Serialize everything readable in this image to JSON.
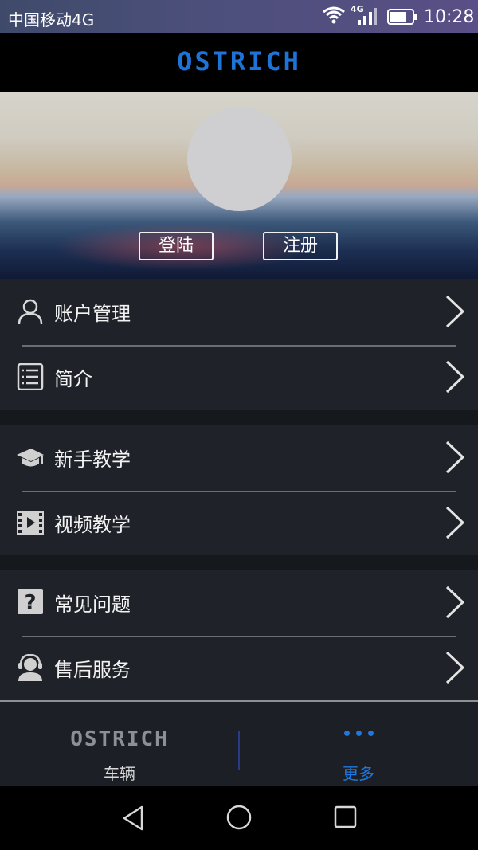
{
  "status_bar": {
    "carrier": "中国移动4G",
    "network_badge": "4G",
    "time": "10:28",
    "icons": [
      "wifi-icon",
      "signal-icon",
      "battery-icon"
    ]
  },
  "app_bar": {
    "logo_text": "OSTRICH"
  },
  "hero": {
    "login_label": "登陆",
    "register_label": "注册"
  },
  "menu": {
    "groups": [
      {
        "items": [
          {
            "label": "账户管理",
            "icon": "user-icon"
          },
          {
            "label": "简介",
            "icon": "list-icon"
          }
        ]
      },
      {
        "items": [
          {
            "label": "新手教学",
            "icon": "graduation-cap-icon"
          },
          {
            "label": "视频教学",
            "icon": "film-icon"
          }
        ]
      },
      {
        "items": [
          {
            "label": "常见问题",
            "icon": "question-icon"
          },
          {
            "label": "售后服务",
            "icon": "headset-icon"
          }
        ]
      }
    ]
  },
  "tab_bar": {
    "tabs": [
      {
        "logo": "OSTRICH",
        "label": "车辆"
      },
      {
        "label": "更多",
        "active": true
      }
    ],
    "accent_color": "#1e78e0"
  },
  "system_nav": {
    "icons": [
      "back-icon",
      "home-icon",
      "recents-icon"
    ]
  }
}
